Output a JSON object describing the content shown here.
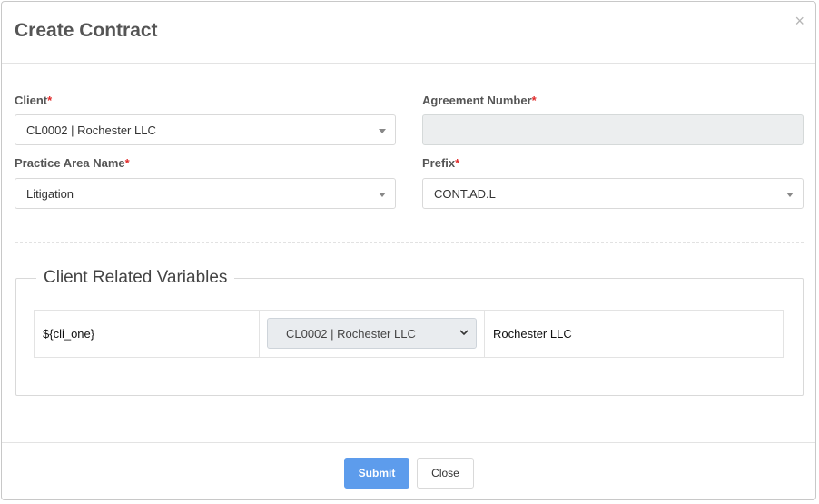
{
  "modal": {
    "title": "Create Contract",
    "close_symbol": "×"
  },
  "form": {
    "client": {
      "label": "Client",
      "required_mark": "*",
      "value": "CL0002 | Rochester LLC"
    },
    "agreement_number": {
      "label": "Agreement Number",
      "required_mark": "*",
      "value": ""
    },
    "practice_area": {
      "label": "Practice Area Name",
      "required_mark": "*",
      "value": "Litigation"
    },
    "prefix": {
      "label": "Prefix",
      "required_mark": "*",
      "value": "CONT.AD.L"
    }
  },
  "client_variables": {
    "legend": "Client Related Variables",
    "rows": [
      {
        "variable": "${cli_one}",
        "selected": "CL0002 | Rochester LLC",
        "resolved": "Rochester LLC"
      }
    ]
  },
  "footer": {
    "submit_label": "Submit",
    "close_label": "Close"
  },
  "colors": {
    "primary": "#5d9cec",
    "required": "#e02b2b"
  }
}
